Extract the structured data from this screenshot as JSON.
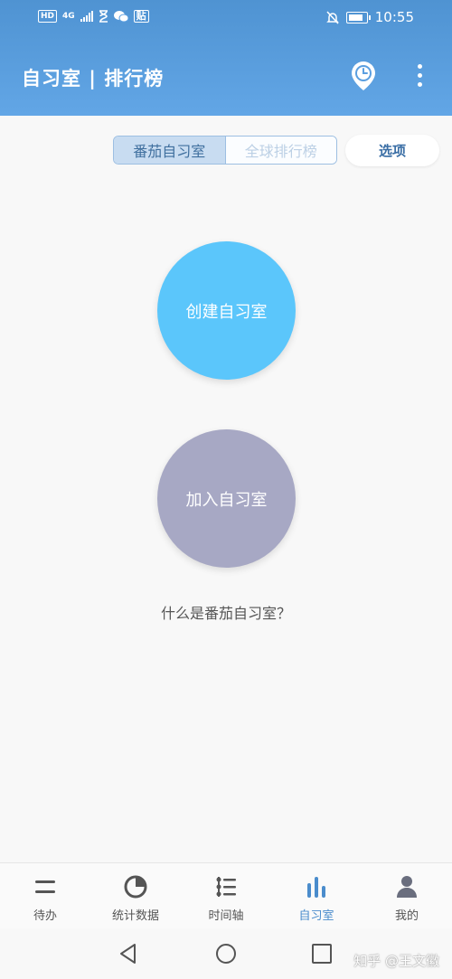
{
  "status_bar": {
    "hd_badge": "HD",
    "network": "4G",
    "post_badge": "贴",
    "time": "10:55"
  },
  "header": {
    "title": "自习室 | 排行榜",
    "icons": [
      "history-icon",
      "more-vert-icon"
    ]
  },
  "tabs": {
    "items": [
      "番茄自习室",
      "全球排行榜"
    ],
    "active_index": 0,
    "options_label": "选项"
  },
  "actions": {
    "create_label": "创建自习室",
    "join_label": "加入自习室",
    "help_link": "什么是番茄自习室？"
  },
  "bottom_nav": {
    "items": [
      {
        "label": "待办",
        "icon": "todo-icon"
      },
      {
        "label": "统计数据",
        "icon": "pie-chart-icon"
      },
      {
        "label": "时间轴",
        "icon": "timeline-icon"
      },
      {
        "label": "自习室",
        "icon": "bar-chart-icon"
      },
      {
        "label": "我的",
        "icon": "person-icon"
      }
    ],
    "active_index": 3
  },
  "system_nav": {
    "icons": [
      "back-icon",
      "home-icon",
      "recents-icon"
    ]
  },
  "watermark": "知乎 @王文徽",
  "colors": {
    "header": "#5b9fe0",
    "create_circle": "#5bc6fb",
    "join_circle": "#a7a8c4",
    "active_nav": "#4a8ccc"
  }
}
